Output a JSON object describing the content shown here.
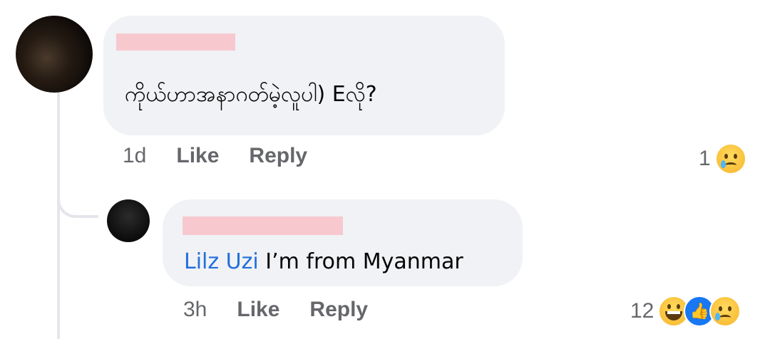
{
  "comments": [
    {
      "text": "ကိုယ်ဟာအနာဂတ်မဲ့လူပါ) Eလို?",
      "time": "1d",
      "like_label": "Like",
      "reply_label": "Reply",
      "reaction_count": "1",
      "reactions": [
        "sad-emoji"
      ]
    },
    {
      "mention": "Lilz Uzi",
      "text": " I’m from Myanmar",
      "time": "3h",
      "like_label": "Like",
      "reply_label": "Reply",
      "reaction_count": "12",
      "reactions": [
        "haha-emoji",
        "like-icon",
        "sad-emoji"
      ]
    }
  ],
  "colors": {
    "bubble": "#f0f2f5",
    "mention": "#216fdb",
    "meta": "#65676b",
    "redaction": "#f8c8cf",
    "like_blue": "#1877f2"
  }
}
